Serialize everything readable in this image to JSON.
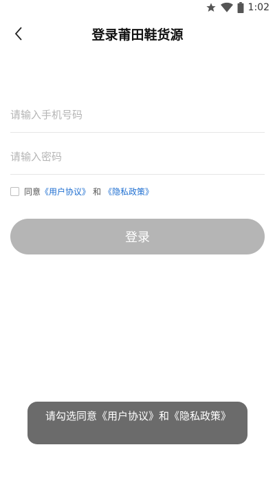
{
  "status_bar": {
    "time": "1:02",
    "icons": [
      "star-icon",
      "wifi-icon",
      "battery-icon"
    ]
  },
  "header": {
    "title": "登录莆田鞋货源",
    "back_icon": "chevron-left-icon"
  },
  "form": {
    "phone_placeholder": "请输入手机号码",
    "phone_value": "",
    "password_placeholder": "请输入密码",
    "password_value": ""
  },
  "agreement": {
    "prefix": "同意",
    "user_agreement": "《用户协议》",
    "and": "和",
    "privacy_policy": "《隐私政策》",
    "checked": false
  },
  "login_button": {
    "label": "登录"
  },
  "toast": {
    "message": "请勾选同意《用户协议》和《隐私政策》"
  },
  "colors": {
    "link": "#1f6fd1",
    "button_disabled": "#b5b5b5",
    "toast_bg": "#6b6b6b"
  }
}
